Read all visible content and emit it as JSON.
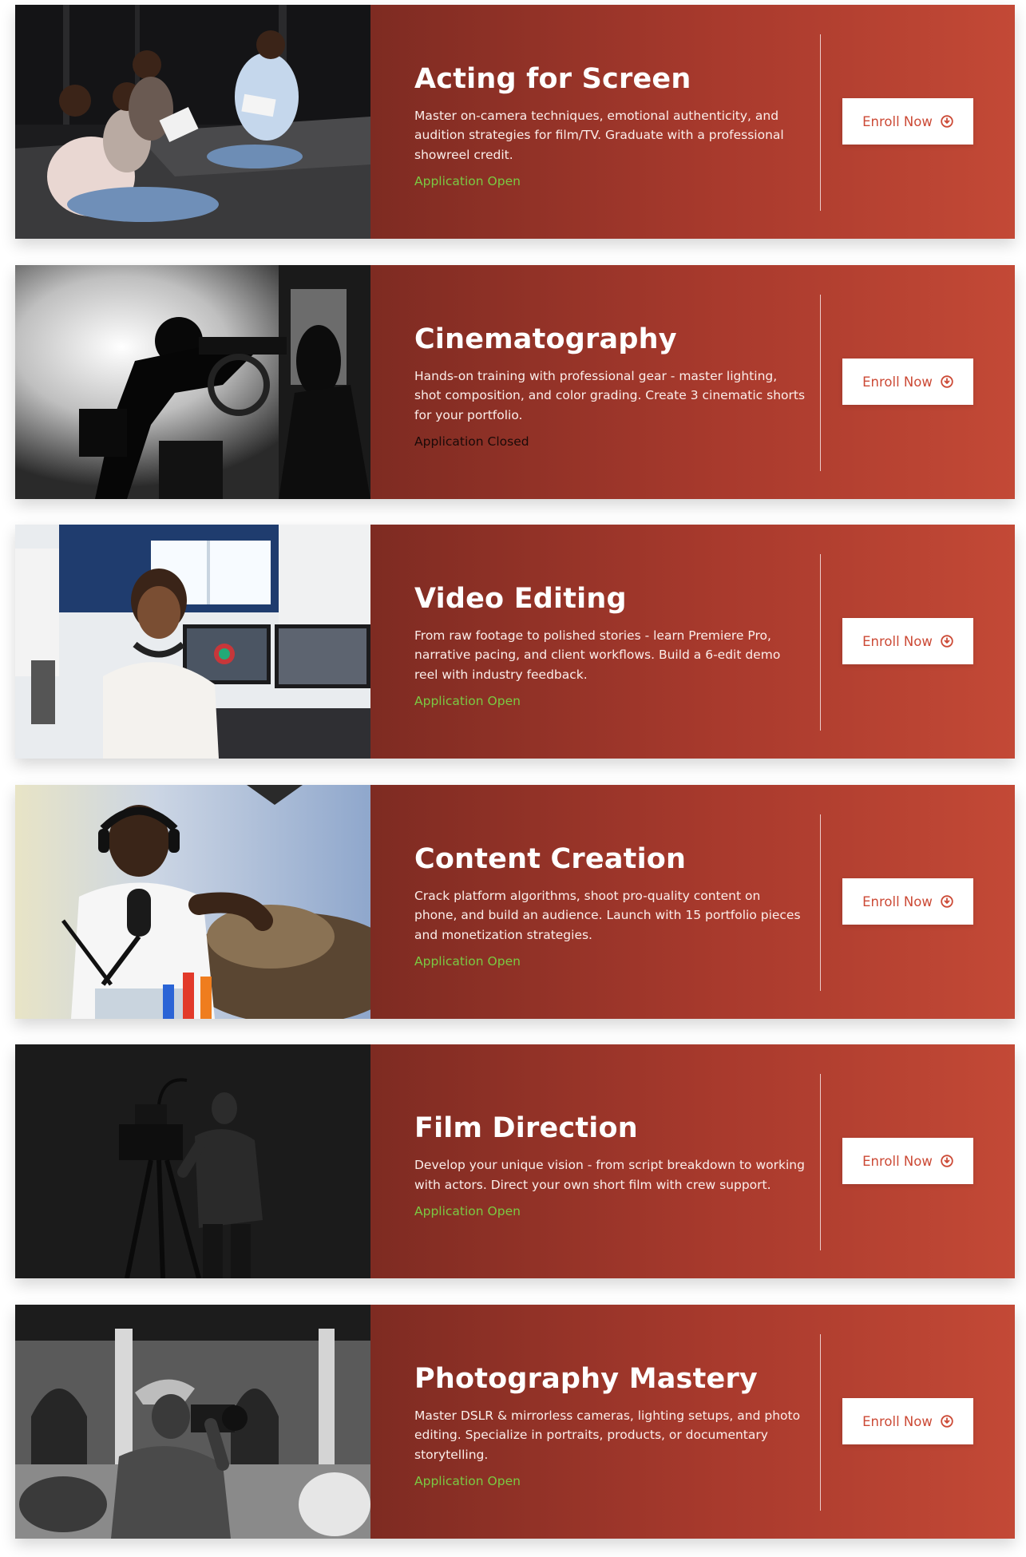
{
  "courses": [
    {
      "title": "Acting for Screen",
      "description": "Master on-camera techniques, emotional authenticity, and audition strategies for film/TV. Graduate with a professional showreel credit.",
      "status": "Application Open",
      "status_color": "#7ac943",
      "button_label": "Enroll Now",
      "button_icon": "arrow-circle-down-icon",
      "image": "acting-class-photo"
    },
    {
      "title": "Cinematography",
      "description": "Hands-on training with professional gear - master lighting, shot composition, and color grading. Create 3 cinematic shorts for your portfolio.",
      "status": "Application Closed",
      "status_color": "#1a0a08",
      "button_label": "Enroll Now",
      "button_icon": "arrow-circle-down-icon",
      "image": "cinematography-set-photo"
    },
    {
      "title": "Video Editing",
      "description": "From raw footage to polished stories - learn Premiere Pro, narrative pacing, and client workflows. Build a 6-edit demo reel with industry feedback.",
      "status": "Application Open",
      "status_color": "#7ac943",
      "button_label": "Enroll Now",
      "button_icon": "arrow-circle-down-icon",
      "image": "video-editor-photo"
    },
    {
      "title": "Content Creation",
      "description": "Crack platform algorithms, shoot pro-quality content on phone, and build an audience. Launch with 15 portfolio pieces and monetization strategies.",
      "status": "Application Open",
      "status_color": "#7ac943",
      "button_label": "Enroll Now",
      "button_icon": "arrow-circle-down-icon",
      "image": "podcast-creator-photo"
    },
    {
      "title": "Film Direction",
      "description": "Develop your unique vision - from script breakdown to working with actors. Direct your own short film with crew support.",
      "status": "Application Open",
      "status_color": "#7ac943",
      "button_label": "Enroll Now",
      "button_icon": "arrow-circle-down-icon",
      "image": "director-camera-photo"
    },
    {
      "title": "Photography Mastery",
      "description": "Master DSLR & mirrorless cameras, lighting setups, and photo editing. Specialize in portraits, products, or documentary storytelling.",
      "status": "Application Open",
      "status_color": "#7ac943",
      "button_label": "Enroll Now",
      "button_icon": "arrow-circle-down-icon",
      "image": "photographer-photo"
    }
  ],
  "colors": {
    "card_gradient_start": "#7e2b22",
    "card_gradient_end": "#c34936",
    "button_text": "#cc4a36",
    "status_open": "#7ac943",
    "status_closed": "#1a0a08"
  }
}
